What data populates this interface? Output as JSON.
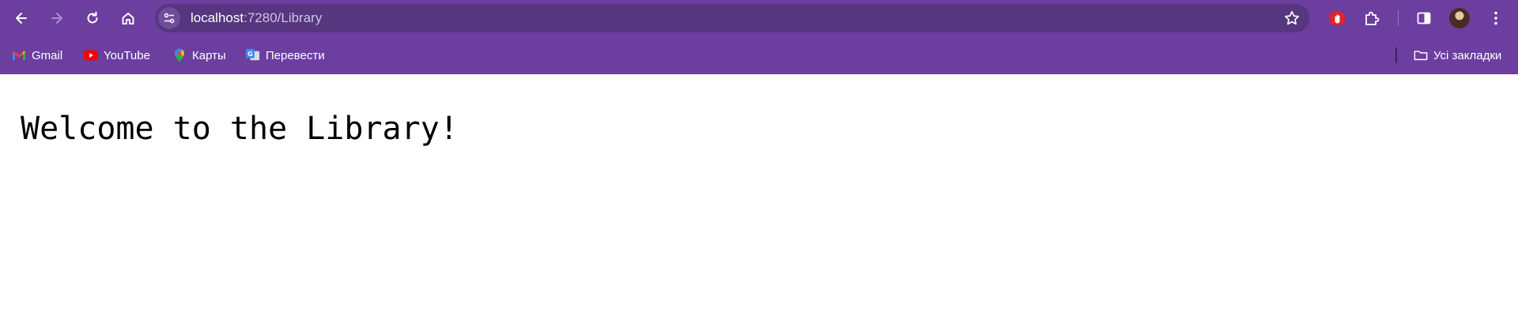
{
  "browser": {
    "address_bar": {
      "host": "localhost",
      "rest": ":7280/Library"
    },
    "icons": {
      "back": "back-arrow-icon",
      "forward": "forward-arrow-icon",
      "reload": "reload-icon",
      "home": "home-icon",
      "site_info": "tune-icon",
      "bookmark_star": "star-icon",
      "extension_stop": "stop-hand-icon",
      "extensions": "puzzle-icon",
      "side_panel": "side-panel-icon",
      "menu": "kebab-menu-icon"
    },
    "colors": {
      "frame": "#6b3ea0",
      "omnibox": "#55367f"
    }
  },
  "bookmarks": {
    "items": [
      {
        "label": "Gmail",
        "icon": "gmail-icon"
      },
      {
        "label": "YouTube",
        "icon": "youtube-icon"
      },
      {
        "label": "Карты",
        "icon": "maps-icon"
      },
      {
        "label": "Перевести",
        "icon": "translate-icon"
      }
    ],
    "all_bookmarks": {
      "label": "Усі закладки",
      "icon": "folder-icon"
    }
  },
  "page": {
    "heading": "Welcome to the Library!"
  }
}
